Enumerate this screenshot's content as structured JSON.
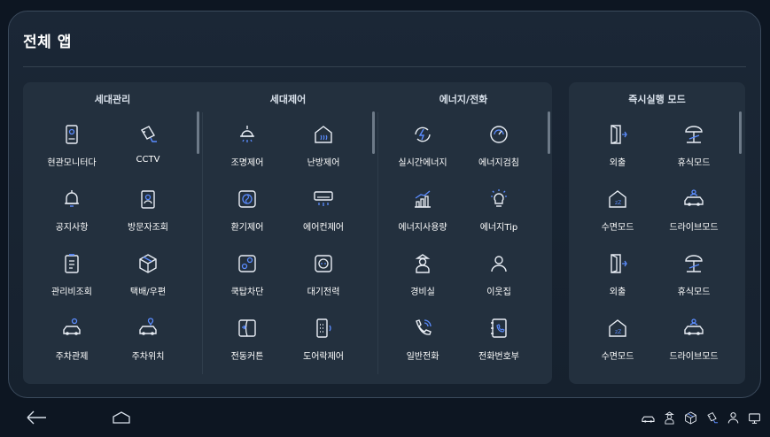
{
  "page": {
    "title": "전체 앱"
  },
  "sections": [
    {
      "title": "세대관리",
      "items": [
        {
          "label": "현관모니터다",
          "icon": "door-monitor-icon"
        },
        {
          "label": "CCTV",
          "icon": "cctv-icon"
        },
        {
          "label": "공지사항",
          "icon": "bell-icon"
        },
        {
          "label": "방문자조회",
          "icon": "visitor-icon"
        },
        {
          "label": "관리비조회",
          "icon": "bill-icon"
        },
        {
          "label": "택배/우편",
          "icon": "parcel-icon"
        },
        {
          "label": "주차관제",
          "icon": "car-pin-icon"
        },
        {
          "label": "주차위치",
          "icon": "car-location-icon"
        }
      ]
    },
    {
      "title": "세대제어",
      "items": [
        {
          "label": "조명제어",
          "icon": "lamp-icon"
        },
        {
          "label": "난방제어",
          "icon": "heating-icon"
        },
        {
          "label": "환기제어",
          "icon": "fan-icon"
        },
        {
          "label": "에어컨제어",
          "icon": "aircon-icon"
        },
        {
          "label": "쿡탑차단",
          "icon": "cooktop-icon"
        },
        {
          "label": "대기전력",
          "icon": "outlet-icon"
        },
        {
          "label": "전동커튼",
          "icon": "curtain-icon"
        },
        {
          "label": "도어락제어",
          "icon": "doorlock-icon"
        }
      ]
    },
    {
      "title": "에너지/전화",
      "items": [
        {
          "label": "실시간에너지",
          "icon": "energy-icon"
        },
        {
          "label": "에너지검침",
          "icon": "meter-icon"
        },
        {
          "label": "에너지사용량",
          "icon": "usage-chart-icon"
        },
        {
          "label": "에너지Tip",
          "icon": "bulb-icon"
        },
        {
          "label": "경비실",
          "icon": "guard-icon"
        },
        {
          "label": "이웃집",
          "icon": "neighbor-icon"
        },
        {
          "label": "일반전화",
          "icon": "phone-icon"
        },
        {
          "label": "전화번호부",
          "icon": "phonebook-icon"
        }
      ]
    }
  ],
  "quick": {
    "title": "즉시실행 모드",
    "items": [
      {
        "label": "외출",
        "icon": "exit-icon"
      },
      {
        "label": "휴식모드",
        "icon": "beach-icon"
      },
      {
        "label": "수면모드",
        "icon": "sleep-home-icon"
      },
      {
        "label": "드라이브모드",
        "icon": "drive-icon"
      },
      {
        "label": "외출",
        "icon": "exit-icon"
      },
      {
        "label": "휴식모드",
        "icon": "beach-icon"
      },
      {
        "label": "수면모드",
        "icon": "sleep-home-icon"
      },
      {
        "label": "드라이브모드",
        "icon": "drive-icon"
      }
    ]
  },
  "colors": {
    "accent": "#5b8cff",
    "icon": "#e9eef5",
    "background": "#0d1622",
    "panel": "#23303e"
  },
  "navbar": {
    "back": "back-arrow-icon",
    "home": "home-icon",
    "status": [
      "car-icon",
      "guard-icon",
      "parcel-icon",
      "cctv-icon",
      "person-icon",
      "cast-icon"
    ]
  }
}
